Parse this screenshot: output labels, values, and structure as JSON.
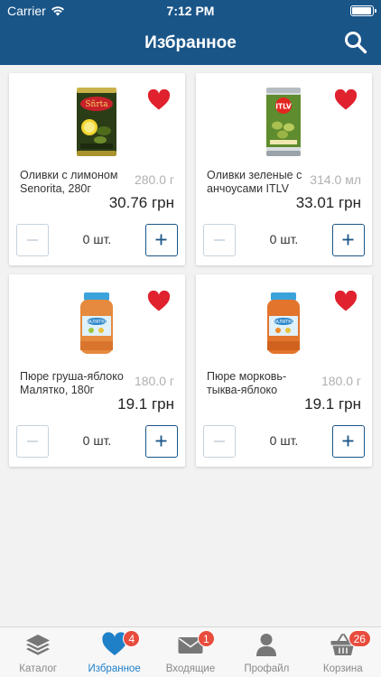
{
  "status_bar": {
    "carrier": "Carrier",
    "time": "7:12 PM",
    "battery_level": 1.0
  },
  "header": {
    "title": "Избранное"
  },
  "colors": {
    "brand": "#1a5588",
    "heart": "#e0212e",
    "active_tab": "#1f80c8",
    "badge": "#e74c3c"
  },
  "products": [
    {
      "name": "Оливки с лимоном Senorita, 280г",
      "weight": "280.0 г",
      "price": "30.76 грн",
      "quantity": "0 шт.",
      "icon": "olive-can-senorita-image",
      "favorite": true
    },
    {
      "name": "Оливки зеленые с анчоусами ITLV",
      "weight": "314.0 мл",
      "price": "33.01 грн",
      "quantity": "0 шт.",
      "icon": "olive-can-itlv-image",
      "favorite": true
    },
    {
      "name": "Пюре груша-яблоко Малятко, 180г",
      "weight": "180.0 г",
      "price": "19.1 грн",
      "quantity": "0 шт.",
      "icon": "puree-jar-image",
      "favorite": true
    },
    {
      "name": "Пюре морковь-тыква-яблоко",
      "weight": "180.0 г",
      "price": "19.1 грн",
      "quantity": "0 шт.",
      "icon": "puree-jar-image",
      "favorite": true
    }
  ],
  "tabbar": {
    "tabs": [
      {
        "label": "Каталог",
        "icon": "catalog-layers-icon",
        "badge": ""
      },
      {
        "label": "Избранное",
        "icon": "heart-icon",
        "badge": "4",
        "active": true
      },
      {
        "label": "Входящие",
        "icon": "envelope-icon",
        "badge": "1"
      },
      {
        "label": "Профайл",
        "icon": "profile-icon",
        "badge": ""
      },
      {
        "label": "Корзина",
        "icon": "basket-icon",
        "badge": "26"
      }
    ]
  }
}
